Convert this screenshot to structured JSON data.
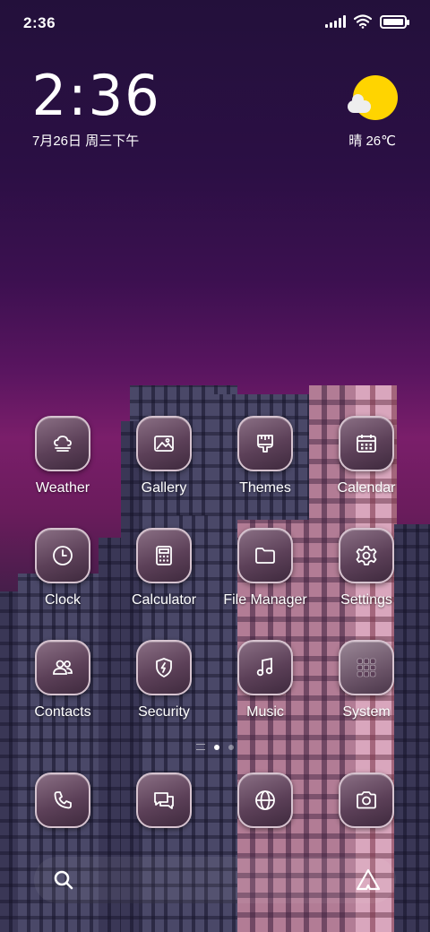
{
  "status_bar": {
    "time": "2:36",
    "battery_level": 1.0
  },
  "clock_widget": {
    "time": "2:36",
    "date": "7月26日 周三下午",
    "weather_icon": "sunny-cloud-icon",
    "temperature": "晴 26℃"
  },
  "apps": [
    {
      "label": "Weather",
      "icon": "weather-icon"
    },
    {
      "label": "Gallery",
      "icon": "gallery-icon"
    },
    {
      "label": "Themes",
      "icon": "themes-icon"
    },
    {
      "label": "Calendar",
      "icon": "calendar-icon"
    },
    {
      "label": "Clock",
      "icon": "clock-icon"
    },
    {
      "label": "Calculator",
      "icon": "calculator-icon"
    },
    {
      "label": "File Manager",
      "icon": "folder-icon"
    },
    {
      "label": "Settings",
      "icon": "gear-icon"
    },
    {
      "label": "Contacts",
      "icon": "contacts-icon"
    },
    {
      "label": "Security",
      "icon": "security-icon"
    },
    {
      "label": "Music",
      "icon": "music-icon"
    },
    {
      "label": "System",
      "icon": "folder-grid-icon"
    }
  ],
  "page_indicator": {
    "pages": 2,
    "active": 1
  },
  "dock": [
    {
      "icon": "phone-icon"
    },
    {
      "icon": "messages-icon"
    },
    {
      "icon": "browser-icon"
    },
    {
      "icon": "camera-icon"
    }
  ],
  "search_bar": {
    "search_icon": "search-icon",
    "assistant_icon": "assistant-icon"
  }
}
